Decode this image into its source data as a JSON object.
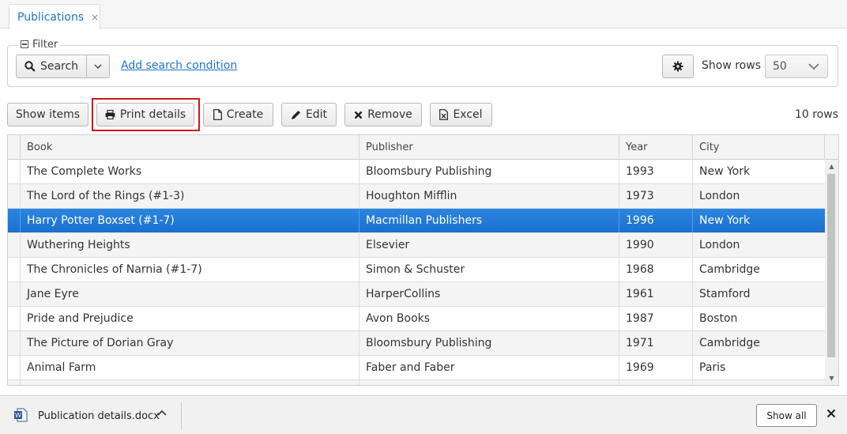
{
  "tab": {
    "label": "Publications",
    "close_glyph": "×"
  },
  "filter": {
    "legend": "Filter",
    "search_label": "Search",
    "add_condition": "Add search condition",
    "show_rows_label": "Show rows",
    "show_rows_value": "50"
  },
  "toolbar": {
    "show_items": "Show items",
    "print_details": "Print details",
    "create": "Create",
    "edit": "Edit",
    "remove": "Remove",
    "excel": "Excel",
    "row_count": "10 rows"
  },
  "grid": {
    "columns": [
      "Book",
      "Publisher",
      "Year",
      "City"
    ],
    "rows": [
      {
        "book": "The Complete Works",
        "publisher": "Bloomsbury Publishing",
        "year": "1993",
        "city": "New York"
      },
      {
        "book": "The Lord of the Rings (#1-3)",
        "publisher": "Houghton Mifflin",
        "year": "1973",
        "city": "London"
      },
      {
        "book": "Harry Potter Boxset (#1-7)",
        "publisher": "Macmillan Publishers",
        "year": "1996",
        "city": "New York",
        "selected": true
      },
      {
        "book": "Wuthering Heights",
        "publisher": "Elsevier",
        "year": "1990",
        "city": "London"
      },
      {
        "book": "The Chronicles of Narnia (#1-7)",
        "publisher": "Simon & Schuster",
        "year": "1968",
        "city": "Cambridge"
      },
      {
        "book": "Jane Eyre",
        "publisher": "HarperCollins",
        "year": "1961",
        "city": "Stamford"
      },
      {
        "book": "Pride and Prejudice",
        "publisher": "Avon Books",
        "year": "1987",
        "city": "Boston"
      },
      {
        "book": "The Picture of Dorian Gray",
        "publisher": "Bloomsbury Publishing",
        "year": "1971",
        "city": "Cambridge"
      },
      {
        "book": "Animal Farm",
        "publisher": "Faber and Faber",
        "year": "1969",
        "city": "Paris"
      },
      {
        "book": "",
        "publisher": "",
        "year": "",
        "city": ""
      }
    ]
  },
  "download_bar": {
    "file_name": "Publication details.docx",
    "show_all": "Show all"
  },
  "colors": {
    "accent": "#1e74c8",
    "selection": "#1a6fcf",
    "highlight_border": "#d0161b"
  }
}
